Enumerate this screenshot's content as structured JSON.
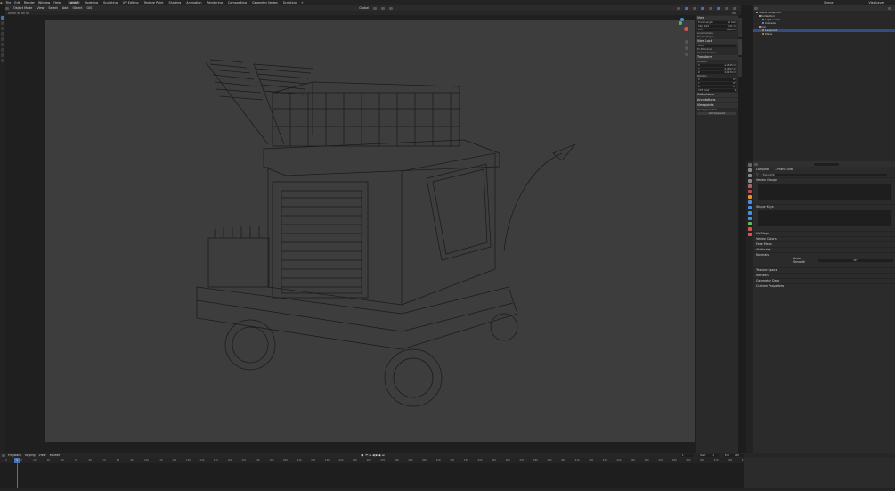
{
  "menu": {
    "items": [
      "File",
      "Edit",
      "Render",
      "Window",
      "Help"
    ],
    "workspaces": [
      "Layout",
      "Modeling",
      "Sculpting",
      "UV Editing",
      "Texture Paint",
      "Shading",
      "Animation",
      "Rendering",
      "Compositing",
      "Geometry Nodes",
      "Scripting"
    ],
    "active_workspace": "Layout",
    "scene": "Scene",
    "view_layer": "ViewLayer"
  },
  "viewport_header": {
    "mode": "Object Mode",
    "menus": [
      "View",
      "Select",
      "Add",
      "Object",
      "GIS"
    ],
    "transform": "Global"
  },
  "npanel": {
    "view_header": "View",
    "lens_label": "Focal Length",
    "lens_value": "50 mm",
    "clip_start_label": "Clip Start",
    "clip_start": "0.01 m",
    "clip_end_label": "End",
    "clip_end": "1000 m",
    "local_camera": "Local Camera",
    "render_region": "Render Region",
    "view_lock": "View Lock",
    "lock_to_object": "Lock",
    "to_3d_cursor": "To 3D Cursor",
    "camera_to_view": "Camera to View",
    "transform_header": "Transform",
    "location_label": "Location",
    "loc": [
      {
        "axis": "X",
        "value": "-1.2345 m"
      },
      {
        "axis": "Y",
        "value": "0.4567 m"
      },
      {
        "axis": "Z",
        "value": "0.1234 m"
      }
    ],
    "rotation_label": "Rotation",
    "rot": [
      {
        "axis": "X",
        "value": "0°"
      },
      {
        "axis": "Y",
        "value": "0°"
      },
      {
        "axis": "Z",
        "value": "0°"
      }
    ],
    "mode": "XYZ Euler",
    "sections": [
      "Collections",
      "Annotations",
      "Viewpoints"
    ],
    "viewpoints_label": "Quick generation",
    "add_button": "Add Viewpoint"
  },
  "outliner": {
    "items": [
      {
        "label": "Scene Collection",
        "color": "#bbbbbb"
      },
      {
        "label": "Collection",
        "color": "#bbbbbb"
      },
      {
        "label": "Light.Lamp",
        "color": "#d99b3a"
      },
      {
        "label": "Camera",
        "color": "#6aa1d8"
      },
      {
        "label": "Car",
        "color": "#bbbbbb"
      },
      {
        "label": "Lampost",
        "color": "#e88d3a"
      },
      {
        "label": "Plane",
        "color": "#e88d3a"
      }
    ]
  },
  "properties": {
    "breadcrumb_object": "Lampost",
    "breadcrumb_data": "Plane.006",
    "data_name": "Plane.006",
    "sections_top": [
      "Vertex Groups",
      "Shape Keys"
    ],
    "sections_mid": [
      "UV Maps",
      "Vertex Colors",
      "Face Maps",
      "Attributes",
      "Normals"
    ],
    "auto_smooth_label": "Auto Smooth",
    "auto_smooth_value": "30°",
    "sections_bottom": [
      "Texture Space",
      "Remesh",
      "Geometry Data",
      "Custom Properties"
    ]
  },
  "timeline": {
    "menus": [
      "Playback",
      "Keying",
      "View",
      "Marker"
    ],
    "current_frame": "1",
    "start_label": "Start",
    "start": "1",
    "end_label": "End",
    "end": "250",
    "ticks": [
      "0",
      "10",
      "20",
      "30",
      "40",
      "50",
      "60",
      "70",
      "80",
      "90",
      "100",
      "110",
      "120",
      "130",
      "140",
      "150",
      "160",
      "170",
      "180",
      "190",
      "200",
      "210",
      "220",
      "230",
      "240",
      "250",
      "260",
      "270",
      "280",
      "290",
      "300",
      "310",
      "320",
      "330",
      "340",
      "350",
      "360",
      "370",
      "380",
      "390",
      "400",
      "410",
      "420",
      "430",
      "440",
      "450",
      "460",
      "470",
      "480",
      "490",
      "500",
      "510",
      "520",
      "530",
      "540"
    ]
  },
  "colors": {
    "accent": "#4772b3",
    "viewport_bg": "#3d3d3d",
    "wire": "#1a1a1a"
  }
}
